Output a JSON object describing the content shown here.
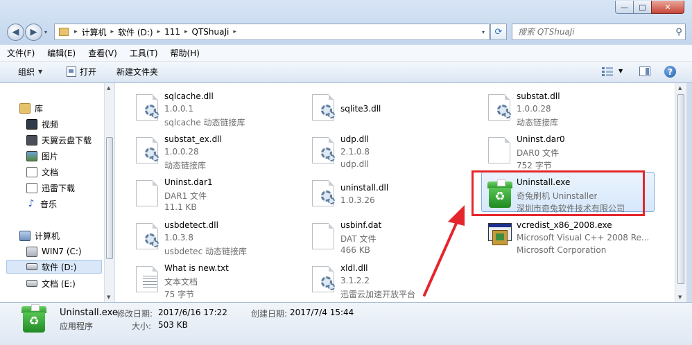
{
  "window": {
    "min_glyph": "—",
    "max_glyph": "□",
    "close_glyph": "✕"
  },
  "nav": {
    "back_glyph": "◀",
    "forward_glyph": "▶",
    "dropdown_glyph": "▾"
  },
  "address": {
    "crumbs": [
      "计算机",
      "软件 (D:)",
      "111",
      "QTShuaJi"
    ],
    "separator": "▸",
    "dropdown_glyph": "▾"
  },
  "refresh_glyph": "⟳",
  "search": {
    "placeholder": "搜索 QTShuaJi",
    "icon_glyph": "⚲"
  },
  "menu": [
    "文件(F)",
    "编辑(E)",
    "查看(V)",
    "工具(T)",
    "帮助(H)"
  ],
  "toolbar": {
    "organize": "组织",
    "open": "打开",
    "new_folder": "新建文件夹",
    "dropdown_glyph": "▼",
    "help_glyph": "?"
  },
  "sidebar": {
    "library_group": {
      "label": "库",
      "items": [
        "视频",
        "天翼云盘下载",
        "图片",
        "文档",
        "迅雷下载",
        "音乐"
      ]
    },
    "computer_group": {
      "label": "计算机",
      "items": [
        "WIN7 (C:)",
        "软件 (D:)",
        "文档 (E:)"
      ],
      "selected_index": 1
    }
  },
  "files": [
    {
      "name": "sqlcache.dll",
      "line2": "1.0.0.1",
      "line3": "sqlcache 动态链接库",
      "icon": "dll-gear-icon"
    },
    {
      "name": "sqlite3.dll",
      "line2": "",
      "line3": "",
      "icon": "dll-gear-icon"
    },
    {
      "name": "substat.dll",
      "line2": "1.0.0.28",
      "line3": "动态链接库",
      "icon": "dll-gear-icon"
    },
    {
      "name": "substat_ex.dll",
      "line2": "1.0.0.28",
      "line3": "动态链接库",
      "icon": "dll-gear-icon"
    },
    {
      "name": "udp.dll",
      "line2": "2.1.0.8",
      "line3": "udp.dll",
      "icon": "dll-gear-icon"
    },
    {
      "name": "Uninst.dar0",
      "line2": "DAR0 文件",
      "line3": "752 字节",
      "icon": "blank-file-icon"
    },
    {
      "name": "Uninst.dar1",
      "line2": "DAR1 文件",
      "line3": "11.1 KB",
      "icon": "blank-file-icon"
    },
    {
      "name": "uninstall.dll",
      "line2": "1.0.3.26",
      "line3": "",
      "icon": "dll-gear-icon"
    },
    {
      "name": "Uninstall.exe",
      "line2": "奇兔刷机 Uninstaller",
      "line3": "深圳市奇兔软件技术有限公司",
      "icon": "recycle-bin-icon",
      "selected": true
    },
    {
      "name": "usbdetect.dll",
      "line2": "1.0.3.8",
      "line3": "usbdetec 动态链接库",
      "icon": "dll-gear-icon"
    },
    {
      "name": "usbinf.dat",
      "line2": "DAT 文件",
      "line3": "466 KB",
      "icon": "blank-file-icon"
    },
    {
      "name": "vcredist_x86_2008.exe",
      "line2": "Microsoft Visual C++ 2008 Re...",
      "line3": "Microsoft Corporation",
      "icon": "installer-box-icon"
    },
    {
      "name": "What is new.txt",
      "line2": "文本文档",
      "line3": "75 字节",
      "icon": "text-file-icon"
    },
    {
      "name": "xldl.dll",
      "line2": "3.1.2.2",
      "line3": "迅雷云加速开放平台",
      "icon": "dll-gear-icon"
    }
  ],
  "status": {
    "name": "Uninstall.exe",
    "type": "应用程序",
    "modified_label": "修改日期:",
    "modified_value": "2017/6/16 17:22",
    "created_label": "创建日期:",
    "created_value": "2017/7/4 15:44",
    "size_label": "大小:",
    "size_value": "503 KB"
  },
  "colors": {
    "annotation_red": "#e5252c",
    "selection_bg": "#d6e8fb",
    "selection_border": "#84acdd",
    "secondary_text": "#6d6d6d"
  }
}
